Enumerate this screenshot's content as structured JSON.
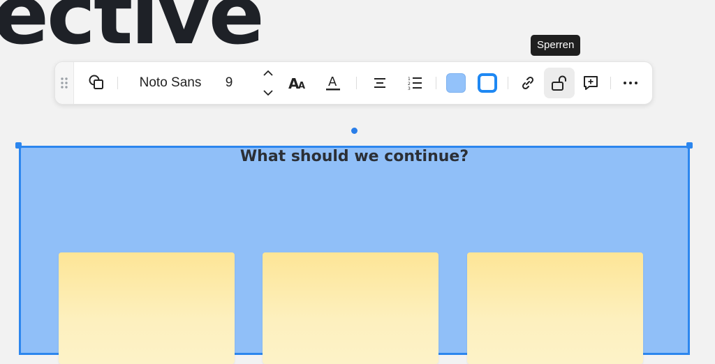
{
  "canvas": {
    "heading_fragment": "ective",
    "frame_title": "What should we continue?"
  },
  "tooltip": {
    "text": "Sperren"
  },
  "toolbar": {
    "font_family": "Noto Sans",
    "font_size": "9",
    "items": [
      "shape-icon",
      "text-size-icon",
      "text-color-icon",
      "align-center-icon",
      "numbered-list-icon",
      "fill-color-swatch",
      "border-color-swatch",
      "link-icon",
      "unlock-icon",
      "comment-icon",
      "more-icon"
    ]
  },
  "colors": {
    "frame_fill": "#90bff8",
    "frame_border": "#2c86ee",
    "fill_swatch": "#93c2fa",
    "border_swatch": "#1e88f3",
    "sticky_note": "#fde596"
  }
}
